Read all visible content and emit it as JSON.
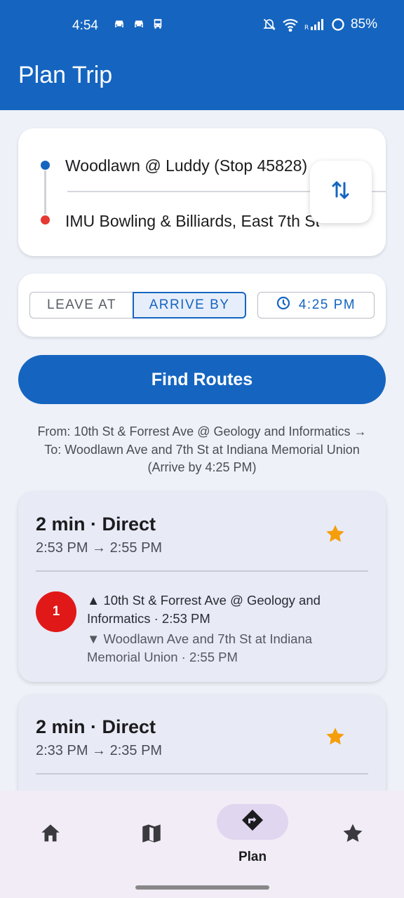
{
  "status_bar": {
    "time": "4:54",
    "battery": "85%",
    "left_icons": [
      "car-notification-icon",
      "car-notification-icon",
      "bus-notification-icon"
    ],
    "right_icons": [
      "mute-icon",
      "wifi-icon",
      "signal-icon",
      "battery-icon"
    ]
  },
  "header": {
    "title": "Plan Trip",
    "color": "#1565c0"
  },
  "trip": {
    "from": "Woodlawn @ Luddy (Stop 45828)",
    "to": "IMU Bowling & Billiards, East 7th Street",
    "swap_icon": "swap-vertical-icon"
  },
  "time_options": {
    "leave_at": "LEAVE AT",
    "arrive_by": "ARRIVE BY",
    "selected": "ARRIVE BY",
    "time": "4:25 PM",
    "clock_icon": "clock-icon"
  },
  "find_button": "Find Routes",
  "summary": {
    "from_line": "From: 10th St & Forrest Ave @ Geology and Informatics →",
    "to_line": "To: Woodlawn Ave and 7th St at Indiana Memorial Union",
    "arrive_line": "(Arrive by 4:25 PM)"
  },
  "routes": [
    {
      "title": "2 min · Direct",
      "times": "2:53 PM → 2:55 PM",
      "favorite": true,
      "line": "1",
      "line_color": "#e11818",
      "board": "▲ 10th St & Forrest Ave @ Geology and Informatics · 2:53 PM",
      "alight": "▼ Woodlawn Ave and 7th St at Indiana Memorial Union · 2:55 PM"
    },
    {
      "title": "2 min · Direct",
      "times": "2:33 PM → 2:35 PM",
      "favorite": true
    }
  ],
  "bottom_nav": {
    "items": [
      {
        "icon": "home-icon",
        "label": ""
      },
      {
        "icon": "map-icon",
        "label": ""
      },
      {
        "icon": "directions-icon",
        "label": "Plan",
        "active": true
      },
      {
        "icon": "star-icon",
        "label": ""
      }
    ]
  },
  "colors": {
    "primary": "#1565c0",
    "favorite": "#f59e0b",
    "destination_dot": "#e53935"
  }
}
